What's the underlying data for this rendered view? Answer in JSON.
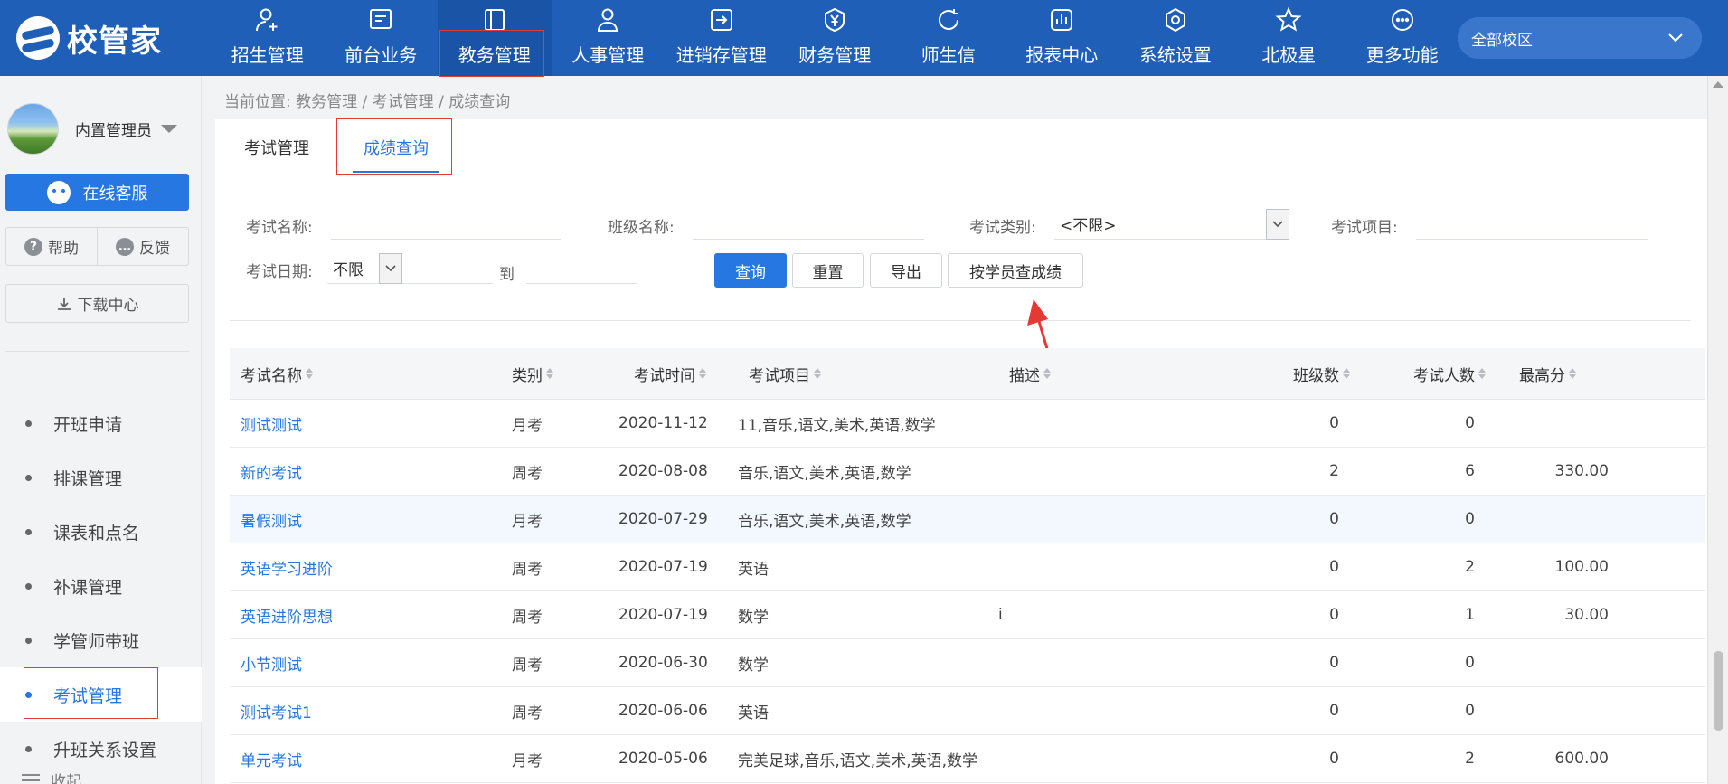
{
  "app": {
    "logo_text": "校管家"
  },
  "nav": [
    {
      "label": "招生管理",
      "icon": "person-add-icon"
    },
    {
      "label": "前台业务",
      "icon": "monitor-icon"
    },
    {
      "label": "教务管理",
      "icon": "book-icon",
      "active": true
    },
    {
      "label": "人事管理",
      "icon": "person-icon"
    },
    {
      "label": "进销存管理",
      "icon": "import-icon"
    },
    {
      "label": "财务管理",
      "icon": "yen-icon"
    },
    {
      "label": "师生信",
      "icon": "chat-icon"
    },
    {
      "label": "报表中心",
      "icon": "chart-icon"
    },
    {
      "label": "系统设置",
      "icon": "gear-icon"
    },
    {
      "label": "北极星",
      "icon": "star-icon"
    },
    {
      "label": "更多功能",
      "icon": "more-icon"
    }
  ],
  "campus": {
    "label": "全部校区"
  },
  "sidebar": {
    "user_name": "内置管理员",
    "online_service": "在线客服",
    "help": "帮助",
    "feedback": "反馈",
    "download": "下载中心",
    "menu": [
      "开班申请",
      "排课管理",
      "课表和点名",
      "补课管理",
      "学管师带班",
      "考试管理",
      "升班关系设置"
    ],
    "active_menu": "考试管理",
    "collapse": "收起"
  },
  "breadcrumb": "当前位置: 教务管理 / 考试管理 / 成绩查询",
  "tabs": {
    "t1": "考试管理",
    "t2": "成绩查询"
  },
  "filters": {
    "exam_name_label": "考试名称:",
    "class_name_label": "班级名称:",
    "exam_type_label": "考试类别:",
    "exam_type_value": "<不限>",
    "exam_item_label": "考试项目:",
    "exam_date_label": "考试日期:",
    "date_mode": "不限",
    "to_label": "到"
  },
  "buttons": {
    "query": "查询",
    "reset": "重置",
    "export": "导出",
    "by_student": "按学员查成绩"
  },
  "table": {
    "headers": {
      "name": "考试名称",
      "category": "类别",
      "time": "考试时间",
      "item": "考试项目",
      "desc": "描述",
      "classes": "班级数",
      "count": "考试人数",
      "max": "最高分"
    },
    "rows": [
      {
        "name": "测试测试",
        "category": "月考",
        "time": "2020-11-12",
        "item": "11,音乐,语文,美术,英语,数学",
        "desc": "",
        "classes": "0",
        "count": "0",
        "max": ""
      },
      {
        "name": "新的考试",
        "category": "周考",
        "time": "2020-08-08",
        "item": "音乐,语文,美术,英语,数学",
        "desc": "",
        "classes": "2",
        "count": "6",
        "max": "330.00"
      },
      {
        "name": "暑假测试",
        "category": "月考",
        "time": "2020-07-29",
        "item": "音乐,语文,美术,英语,数学",
        "desc": "",
        "classes": "0",
        "count": "0",
        "max": ""
      },
      {
        "name": "英语学习进阶",
        "category": "周考",
        "time": "2020-07-19",
        "item": "英语",
        "desc": "",
        "classes": "0",
        "count": "2",
        "max": "100.00"
      },
      {
        "name": "英语进阶思想",
        "category": "周考",
        "time": "2020-07-19",
        "item": "数学",
        "desc": "i",
        "classes": "0",
        "count": "1",
        "max": "30.00"
      },
      {
        "name": "小节测试",
        "category": "周考",
        "time": "2020-06-30",
        "item": "数学",
        "desc": "",
        "classes": "0",
        "count": "0",
        "max": ""
      },
      {
        "name": "测试考试1",
        "category": "周考",
        "time": "2020-06-06",
        "item": "英语",
        "desc": "",
        "classes": "0",
        "count": "0",
        "max": ""
      },
      {
        "name": "单元考试",
        "category": "月考",
        "time": "2020-05-06",
        "item": "完美足球,音乐,语文,美术,英语,数学",
        "desc": "",
        "classes": "0",
        "count": "2",
        "max": "600.00"
      }
    ]
  },
  "colors": {
    "topbar": "#1f5fb8",
    "accent": "#2777e3",
    "highlight_box": "#e53935"
  }
}
